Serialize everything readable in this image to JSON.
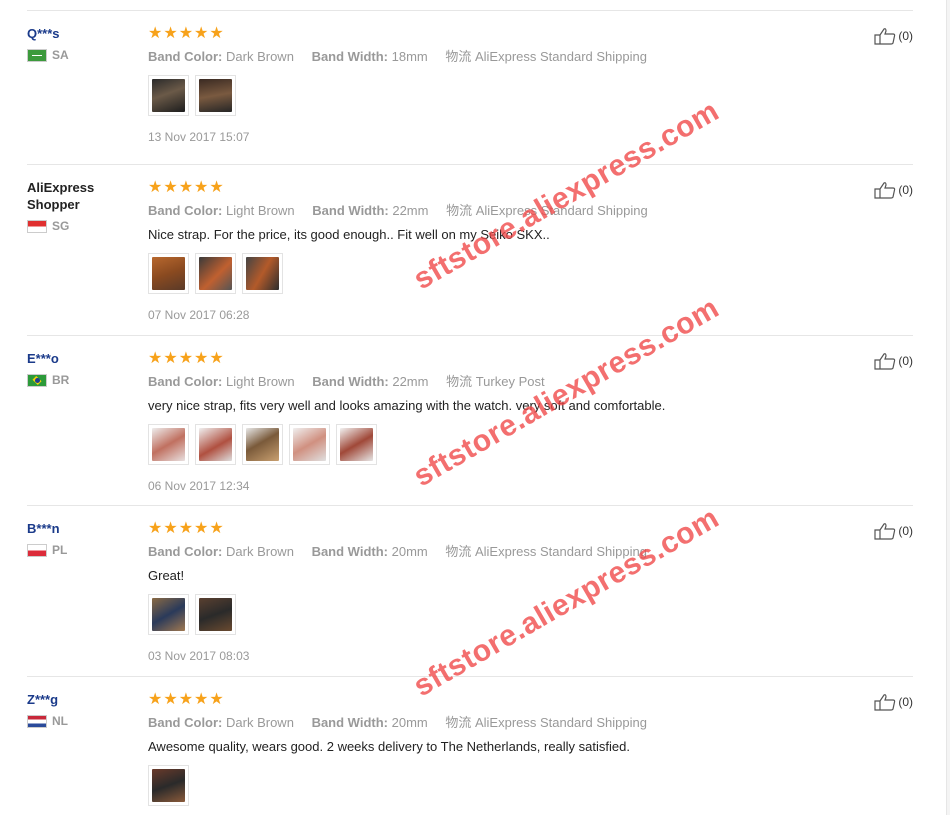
{
  "watermark": "sftstore.aliexpress.com",
  "colors": {
    "star": "#f7a21b",
    "user_link": "#1a3a8a",
    "muted": "#999999",
    "watermark": "#f04646"
  },
  "reviews": [
    {
      "user": "Q***s",
      "country": "SA",
      "flag": "sa-flag",
      "stars": 5,
      "band_color_label": "Band Color:",
      "band_color": "Dark Brown",
      "band_width_label": "Band Width:",
      "band_width": "18mm",
      "shipping": "物流 AliExpress Standard Shipping",
      "comment": "",
      "photos": 2,
      "date": "13 Nov 2017 15:07",
      "helpful": "(0)"
    },
    {
      "user": "AliExpress Shopper",
      "country": "SG",
      "flag": "sg-flag",
      "stars": 5,
      "band_color_label": "Band Color:",
      "band_color": "Light Brown",
      "band_width_label": "Band Width:",
      "band_width": "22mm",
      "shipping": "物流 AliExpress Standard Shipping",
      "comment": "Nice strap. For the price, its good enough.. Fit well on my Seiko SKX..",
      "photos": 3,
      "date": "07 Nov 2017 06:28",
      "helpful": "(0)"
    },
    {
      "user": "E***o",
      "country": "BR",
      "flag": "br-flag",
      "stars": 5,
      "band_color_label": "Band Color:",
      "band_color": "Light Brown",
      "band_width_label": "Band Width:",
      "band_width": "22mm",
      "shipping": "物流 Turkey Post",
      "comment": "very nice strap, fits very well and looks amazing with the watch. very soft and comfortable.",
      "photos": 5,
      "date": "06 Nov 2017 12:34",
      "helpful": "(0)"
    },
    {
      "user": "B***n",
      "country": "PL",
      "flag": "pl-flag",
      "stars": 5,
      "band_color_label": "Band Color:",
      "band_color": "Dark Brown",
      "band_width_label": "Band Width:",
      "band_width": "20mm",
      "shipping": "物流 AliExpress Standard Shipping",
      "comment": "Great!",
      "photos": 2,
      "date": "03 Nov 2017 08:03",
      "helpful": "(0)"
    },
    {
      "user": "Z***g",
      "country": "NL",
      "flag": "nl-flag",
      "stars": 5,
      "band_color_label": "Band Color:",
      "band_color": "Dark Brown",
      "band_width_label": "Band Width:",
      "band_width": "20mm",
      "shipping": "物流 AliExpress Standard Shipping",
      "comment": "Awesome quality, wears good. 2 weeks delivery to The Netherlands, really satisfied.",
      "photos": 1,
      "date": "",
      "helpful": "(0)"
    }
  ]
}
